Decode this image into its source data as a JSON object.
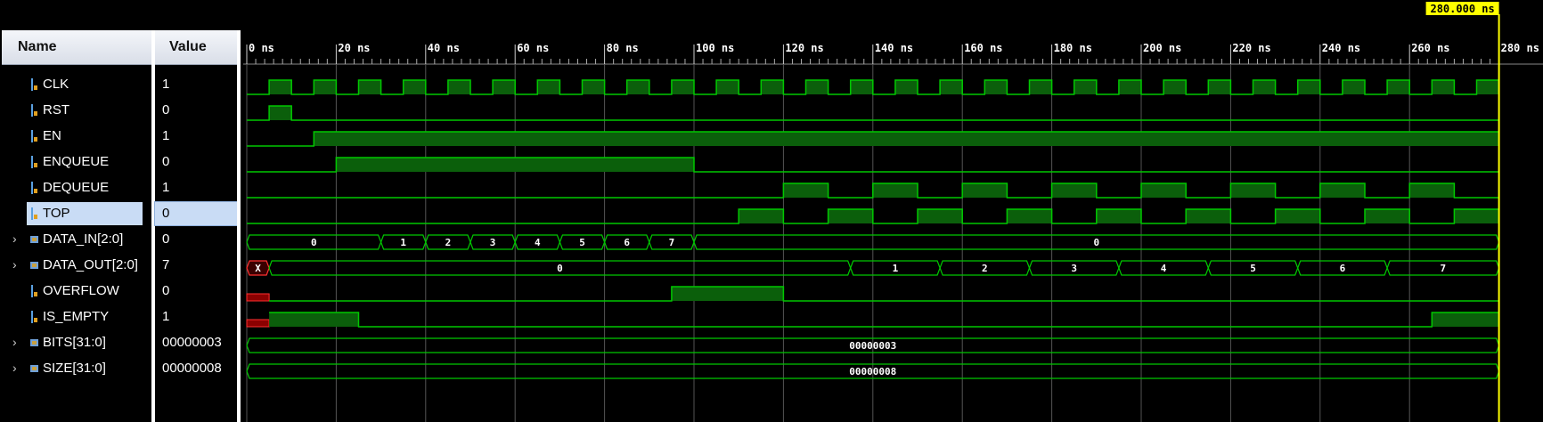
{
  "columns": {
    "name": "Name",
    "value": "Value"
  },
  "signals": [
    {
      "name": "CLK",
      "value": "1",
      "bus": false
    },
    {
      "name": "RST",
      "value": "0",
      "bus": false
    },
    {
      "name": "EN",
      "value": "1",
      "bus": false
    },
    {
      "name": "ENQUEUE",
      "value": "0",
      "bus": false
    },
    {
      "name": "DEQUEUE",
      "value": "1",
      "bus": false
    },
    {
      "name": "TOP",
      "value": "0",
      "bus": false,
      "selected": true
    },
    {
      "name": "DATA_IN[2:0]",
      "value": "0",
      "bus": true
    },
    {
      "name": "DATA_OUT[2:0]",
      "value": "7",
      "bus": true
    },
    {
      "name": "OVERFLOW",
      "value": "0",
      "bus": false
    },
    {
      "name": "IS_EMPTY",
      "value": "1",
      "bus": false
    },
    {
      "name": "BITS[31:0]",
      "value": "00000003",
      "bus": true
    },
    {
      "name": "SIZE[31:0]",
      "value": "00000008",
      "bus": true
    }
  ],
  "timeline": {
    "ticks": [
      "0 ns",
      "20 ns",
      "40 ns",
      "60 ns",
      "80 ns",
      "100 ns",
      "120 ns",
      "140 ns",
      "160 ns",
      "180 ns",
      "200 ns",
      "220 ns",
      "240 ns",
      "260 ns",
      "280 ns"
    ],
    "cursor_label": "280.000 ns",
    "cursor_time": 280
  },
  "waves": {
    "CLK": {
      "clock_period": 10,
      "first_rise": 5
    },
    "RST": [
      [
        0,
        0
      ],
      [
        5,
        1
      ],
      [
        10,
        0
      ]
    ],
    "EN": [
      [
        0,
        0
      ],
      [
        15,
        1
      ]
    ],
    "ENQUEUE": [
      [
        0,
        0
      ],
      [
        20,
        1
      ],
      [
        100,
        0
      ]
    ],
    "DEQUEUE": [
      [
        0,
        0
      ],
      [
        120,
        1
      ],
      [
        130,
        0
      ],
      [
        140,
        1
      ],
      [
        150,
        0
      ],
      [
        160,
        1
      ],
      [
        170,
        0
      ],
      [
        180,
        1
      ],
      [
        190,
        0
      ],
      [
        200,
        1
      ],
      [
        210,
        0
      ],
      [
        220,
        1
      ],
      [
        230,
        0
      ],
      [
        240,
        1
      ],
      [
        250,
        0
      ],
      [
        260,
        1
      ],
      [
        270,
        0
      ]
    ],
    "TOP": [
      [
        0,
        0
      ],
      [
        110,
        1
      ],
      [
        120,
        0
      ],
      [
        130,
        1
      ],
      [
        140,
        0
      ],
      [
        150,
        1
      ],
      [
        160,
        0
      ],
      [
        170,
        1
      ],
      [
        180,
        0
      ],
      [
        190,
        1
      ],
      [
        200,
        0
      ],
      [
        210,
        1
      ],
      [
        220,
        0
      ],
      [
        230,
        1
      ],
      [
        240,
        0
      ],
      [
        250,
        1
      ],
      [
        260,
        0
      ],
      [
        270,
        1
      ]
    ],
    "OVERFLOW": [
      [
        0,
        "x"
      ],
      [
        5,
        0
      ],
      [
        95,
        1
      ],
      [
        120,
        0
      ]
    ],
    "IS_EMPTY": [
      [
        0,
        "x"
      ],
      [
        5,
        1
      ],
      [
        25,
        0
      ],
      [
        265,
        1
      ]
    ],
    "DATA_IN": [
      [
        0,
        "0"
      ],
      [
        30,
        "1"
      ],
      [
        40,
        "2"
      ],
      [
        50,
        "3"
      ],
      [
        60,
        "4"
      ],
      [
        70,
        "5"
      ],
      [
        80,
        "6"
      ],
      [
        90,
        "7"
      ],
      [
        100,
        "0"
      ]
    ],
    "DATA_OUT": [
      [
        0,
        "X"
      ],
      [
        5,
        "0"
      ],
      [
        135,
        "1"
      ],
      [
        155,
        "2"
      ],
      [
        175,
        "3"
      ],
      [
        195,
        "4"
      ],
      [
        215,
        "5"
      ],
      [
        235,
        "6"
      ],
      [
        255,
        "7"
      ]
    ],
    "BITS": [
      [
        0,
        "00000003"
      ]
    ],
    "SIZE": [
      [
        0,
        "00000008"
      ]
    ]
  },
  "colors": {
    "wave": "#00c800",
    "fill": "#0b5f0b",
    "xfill": "#8b0000",
    "cursor": "#ffff00",
    "grid": "#555555"
  }
}
